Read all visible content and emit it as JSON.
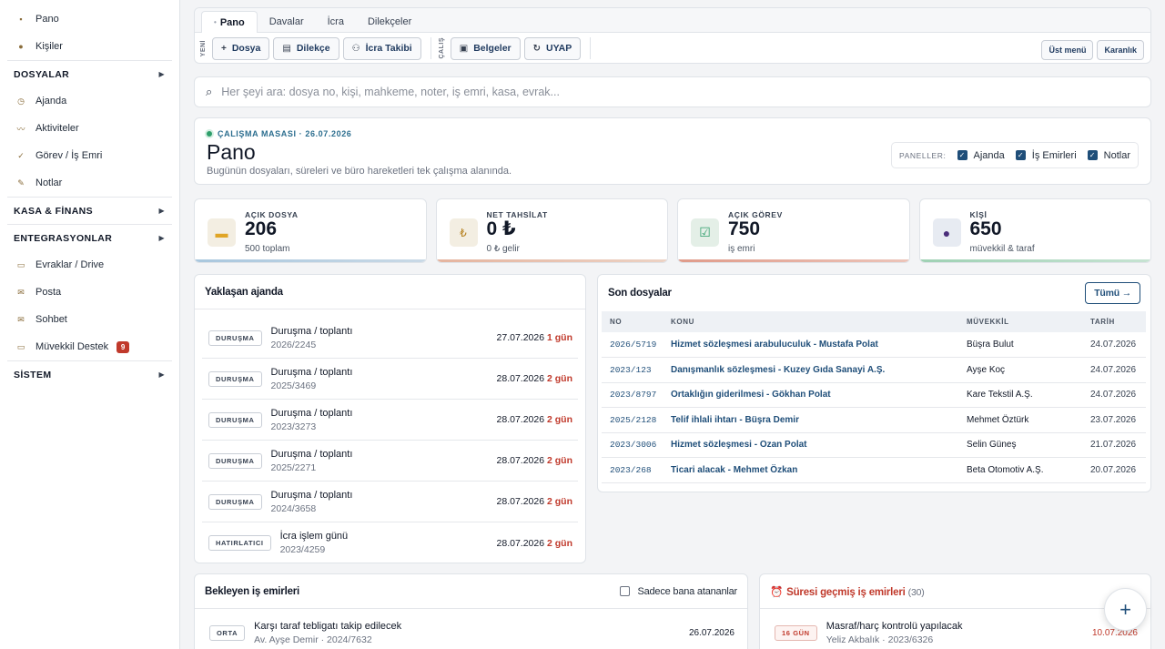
{
  "sidebar": {
    "items_top": [
      {
        "label": "Pano",
        "icon": "dashboard-icon"
      },
      {
        "label": "Kişiler",
        "icon": "people-icon"
      }
    ],
    "section_dosyalar": "DOSYALAR",
    "items_dosyalar": [
      {
        "label": "Ajanda",
        "icon": "clock-icon"
      },
      {
        "label": "Aktiviteler",
        "icon": "activity-icon"
      },
      {
        "label": "Görev / İş Emri",
        "icon": "check-icon"
      },
      {
        "label": "Notlar",
        "icon": "pen-icon"
      }
    ],
    "section_kasa": "KASA & FİNANS",
    "section_entegrasyon": "ENTEGRASYONLAR",
    "items_entegrasyon": [
      {
        "label": "Evraklar / Drive",
        "icon": "folder-icon"
      },
      {
        "label": "Posta",
        "icon": "mail-icon"
      },
      {
        "label": "Sohbet",
        "icon": "chat-icon"
      },
      {
        "label": "Müvekkil Destek",
        "icon": "support-icon",
        "badge": "9"
      }
    ],
    "section_sistem": "SİSTEM"
  },
  "tabs": [
    "Pano",
    "Davalar",
    "İcra",
    "Dilekçeler"
  ],
  "toolbar": {
    "group1_label": "YENİ",
    "group2_label": "ÇALIŞ",
    "btn_dosya": "Dosya",
    "btn_dilekce": "Dilekçe",
    "btn_icra": "İcra Takibi",
    "btn_belgeler": "Belgeler",
    "btn_uyap": "UYAP",
    "btn_ust_menu": "Üst menü",
    "btn_karanlik": "Karanlık"
  },
  "search": {
    "placeholder": "Her şeyi ara: dosya no, kişi, mahkeme, noter, iş emri, kasa, evrak..."
  },
  "hero": {
    "eyebrow": "ÇALIŞMA MASASI · 26.07.2026",
    "title": "Pano",
    "subtitle": "Bugünün dosyaları, süreleri ve büro hareketleri tek çalışma alanında.",
    "panels_label": "PANELLER:",
    "panel_ajanda": "Ajanda",
    "panel_is_emirleri": "İş Emirleri",
    "panel_notlar": "Notlar"
  },
  "stats": [
    {
      "label": "AÇIK DOSYA",
      "value": "206",
      "sub": "500 toplam",
      "icon": "folder-icon",
      "color": "#e0a526"
    },
    {
      "label": "NET TAHSİLAT",
      "value": "0 ₺",
      "sub": "0 ₺ gelir",
      "icon": "lira-icon",
      "color": "#d9826b"
    },
    {
      "label": "AÇIK GÖREV",
      "value": "750",
      "sub": "iş emri",
      "icon": "task-icon",
      "color": "#d9826b"
    },
    {
      "label": "KİŞİ",
      "value": "650",
      "sub": "müvekkil & taraf",
      "icon": "person-icon",
      "color": "#7bbf9a"
    }
  ],
  "agenda": {
    "title": "Yaklaşan ajanda",
    "rows": [
      {
        "tag": "DURUŞMA",
        "title": "Duruşma / toplantı",
        "ref": "2026/2245",
        "date": "27.07.2026",
        "days": "1 gün"
      },
      {
        "tag": "DURUŞMA",
        "title": "Duruşma / toplantı",
        "ref": "2025/3469",
        "date": "28.07.2026",
        "days": "2 gün"
      },
      {
        "tag": "DURUŞMA",
        "title": "Duruşma / toplantı",
        "ref": "2023/3273",
        "date": "28.07.2026",
        "days": "2 gün"
      },
      {
        "tag": "DURUŞMA",
        "title": "Duruşma / toplantı",
        "ref": "2025/2271",
        "date": "28.07.2026",
        "days": "2 gün"
      },
      {
        "tag": "DURUŞMA",
        "title": "Duruşma / toplantı",
        "ref": "2024/3658",
        "date": "28.07.2026",
        "days": "2 gün"
      },
      {
        "tag": "HATIRLATICI",
        "title": "İcra işlem günü",
        "ref": "2023/4259",
        "date": "28.07.2026",
        "days": "2 gün"
      }
    ]
  },
  "recent": {
    "title": "Son dosyalar",
    "all_label": "Tümü →",
    "columns": [
      "NO",
      "KONU",
      "MÜVEKKİL",
      "TARİH"
    ],
    "rows": [
      {
        "no": "2026/5719",
        "konu": "Hizmet sözleşmesi arabuluculuk - Mustafa Polat",
        "muvekkil": "Büşra Bulut",
        "tarih": "24.07.2026"
      },
      {
        "no": "2023/123",
        "konu": "Danışmanlık sözleşmesi - Kuzey Gıda Sanayi A.Ş.",
        "muvekkil": "Ayşe Koç",
        "tarih": "24.07.2026"
      },
      {
        "no": "2023/8797",
        "konu": "Ortaklığın giderilmesi - Gökhan Polat",
        "muvekkil": "Kare Tekstil A.Ş.",
        "tarih": "24.07.2026"
      },
      {
        "no": "2025/2128",
        "konu": "Telif ihlali ihtarı - Büşra Demir",
        "muvekkil": "Mehmet Öztürk",
        "tarih": "23.07.2026"
      },
      {
        "no": "2023/3006",
        "konu": "Hizmet sözleşmesi - Ozan Polat",
        "muvekkil": "Selin Güneş",
        "tarih": "21.07.2026"
      },
      {
        "no": "2023/268",
        "konu": "Ticari alacak - Mehmet Özkan",
        "muvekkil": "Beta Otomotiv A.Ş.",
        "tarih": "20.07.2026"
      }
    ]
  },
  "pending": {
    "title": "Bekleyen iş emirleri",
    "only_me": "Sadece bana atananlar",
    "row": {
      "tag": "ORTA",
      "title": "Karşı taraf tebligatı takip edilecek",
      "meta": "Av. Ayşe Demir · 2024/7632",
      "date": "26.07.2026"
    }
  },
  "overdue": {
    "title": "Süresi geçmiş iş emirleri",
    "count": "(30)",
    "row": {
      "tag": "16 GÜN",
      "title": "Masraf/harç kontrolü yapılacak",
      "meta": "Yeliz Akbalık · 2023/6326",
      "date": "10.07.2026"
    }
  },
  "fab_label": "+"
}
